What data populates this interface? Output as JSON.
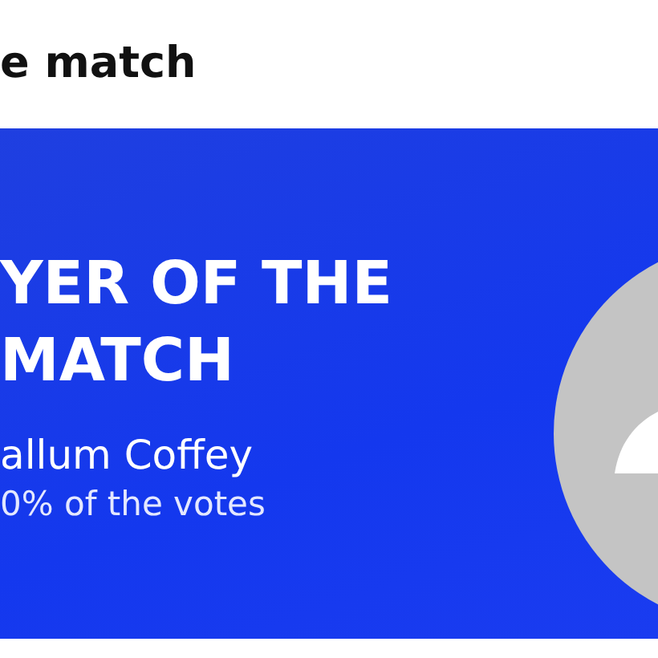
{
  "page_title": "e match",
  "banner": {
    "heading_lines": [
      "YER OF THE",
      "MATCH"
    ],
    "player_name": "allum Coffey",
    "votes": "0% of the votes"
  }
}
